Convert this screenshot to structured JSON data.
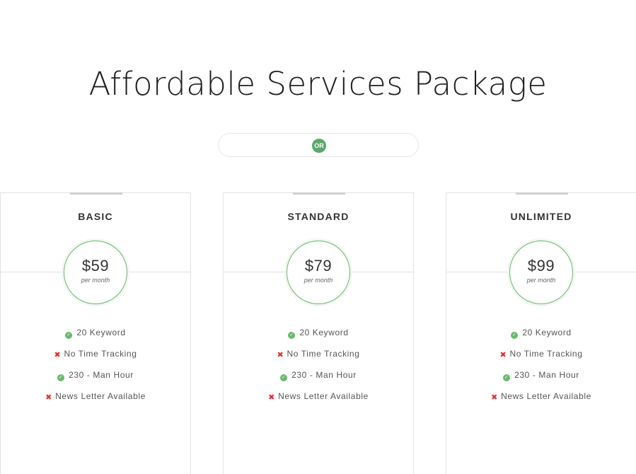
{
  "header": {
    "title": "Affordable Services Package"
  },
  "toggle": {
    "or_label": "OR"
  },
  "colors": {
    "accent_green": "#6ab86f",
    "cross_red": "#e03030",
    "badge_green": "#5aa86a"
  },
  "plans": [
    {
      "name": "BASIC",
      "price": "$59",
      "period": "per month",
      "features": [
        {
          "text": "20 Keyword",
          "included": true,
          "icon": "check-icon"
        },
        {
          "text": "No Time Tracking",
          "included": false,
          "icon": "cross-icon"
        },
        {
          "text": "230 - Man Hour",
          "included": true,
          "icon": "check-icon"
        },
        {
          "text": "News Letter Available",
          "included": false,
          "icon": "cross-icon"
        }
      ]
    },
    {
      "name": "STANDARD",
      "price": "$79",
      "period": "per month",
      "features": [
        {
          "text": "20 Keyword",
          "included": true,
          "icon": "check-icon"
        },
        {
          "text": "No Time Tracking",
          "included": false,
          "icon": "cross-icon"
        },
        {
          "text": "230 - Man Hour",
          "included": true,
          "icon": "check-icon"
        },
        {
          "text": "News Letter Available",
          "included": false,
          "icon": "cross-icon"
        }
      ]
    },
    {
      "name": "UNLIMITED",
      "price": "$99",
      "period": "per month",
      "features": [
        {
          "text": "20 Keyword",
          "included": true,
          "icon": "check-icon"
        },
        {
          "text": "No Time Tracking",
          "included": false,
          "icon": "cross-icon"
        },
        {
          "text": "230 - Man Hour",
          "included": true,
          "icon": "check-icon"
        },
        {
          "text": "News Letter Available",
          "included": false,
          "icon": "cross-icon"
        }
      ]
    }
  ]
}
